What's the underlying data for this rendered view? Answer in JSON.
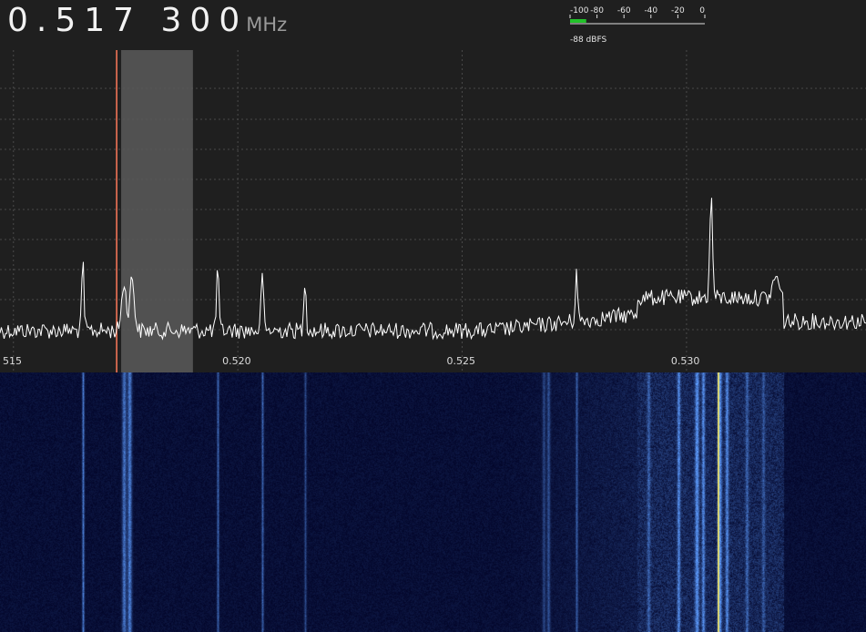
{
  "tuner": {
    "frequency_digits": "0.517 300",
    "unit": "MHz"
  },
  "smeter": {
    "scale_labels": [
      "-100",
      "-80",
      "-60",
      "-40",
      "-20",
      "0"
    ],
    "scale_min": -100,
    "scale_max": 0,
    "level_dbfs": -88,
    "readout": "-88 dBFS",
    "bar_color": "#22c22a"
  },
  "spectrum": {
    "freq_min_mhz": 0.5147,
    "freq_max_mhz": 0.534,
    "tick_labels": [
      {
        "value": 0.515,
        "label": "515"
      },
      {
        "value": 0.52,
        "label": "0.520"
      },
      {
        "value": 0.525,
        "label": "0.525"
      },
      {
        "value": 0.53,
        "label": "0.530"
      }
    ],
    "tuned_freq_mhz": 0.5173,
    "passband_mhz": [
      0.5174,
      0.519
    ],
    "peaks_mhz": [
      0.5166,
      0.5176,
      0.5177,
      0.5198,
      0.5206,
      0.5215,
      0.5278,
      0.5306
    ],
    "trace_color": "#ffffff",
    "tuning_line_color": "#ff7a5a",
    "passband_color": "#5a5a5a",
    "grid_color": "#4a4a4a"
  },
  "waterfall": {
    "background_color": "#03062a",
    "signal_color": "#3c6cff",
    "carrier_color": "#e8e070",
    "carrier_mhz": 0.5307
  }
}
